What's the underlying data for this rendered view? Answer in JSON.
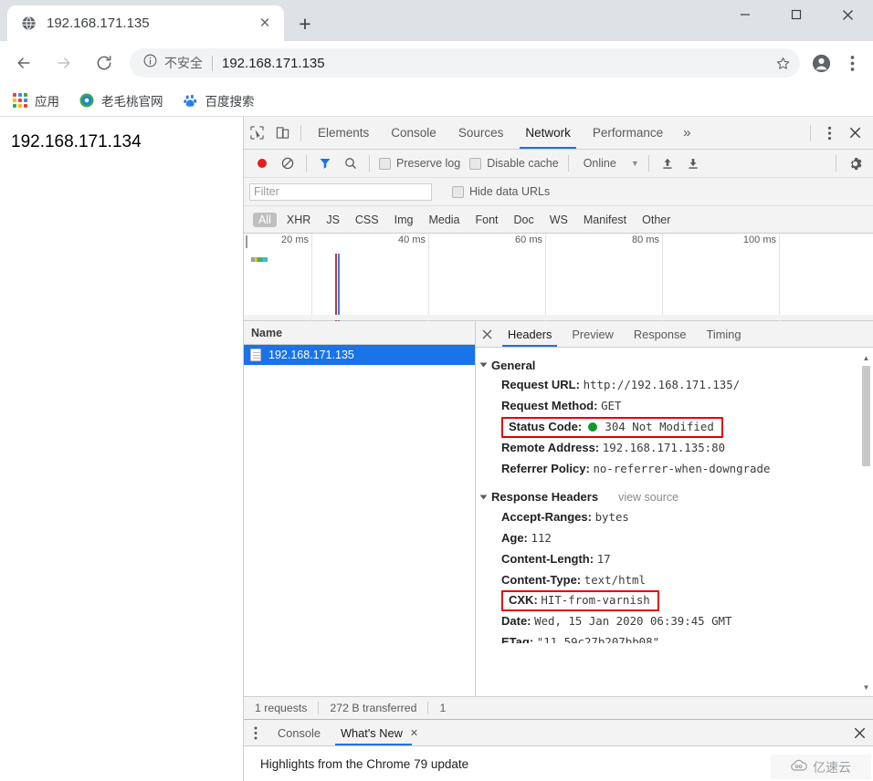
{
  "browser": {
    "tab": {
      "title": "192.168.171.135",
      "favicon": "globe-icon",
      "close": "×"
    },
    "newtab_label": "+",
    "window_controls": {
      "minimize": "—",
      "maximize": "□",
      "close": "✕"
    },
    "nav": {
      "back": "←",
      "forward": "→",
      "reload": "↻"
    },
    "omnibox": {
      "security_icon": "info-circle-icon",
      "security_text": "不安全",
      "url": "192.168.171.135",
      "star": "☆"
    },
    "profile_icon": "account-circle-icon",
    "menu_icon": "kebab-menu-icon",
    "bookmarks": [
      {
        "icon": "apps-grid-icon",
        "label": "应用"
      },
      {
        "icon": "laomaotao-icon",
        "label": "老毛桃官网"
      },
      {
        "icon": "baidu-paw-icon",
        "label": "百度搜索"
      }
    ]
  },
  "page": {
    "body_text": "192.168.171.134"
  },
  "devtools": {
    "inspect_icon": "inspect-element-icon",
    "device_icon": "device-toolbar-icon",
    "panels": [
      {
        "label": "Elements",
        "active": false
      },
      {
        "label": "Console",
        "active": false
      },
      {
        "label": "Sources",
        "active": false
      },
      {
        "label": "Network",
        "active": true
      },
      {
        "label": "Performance",
        "active": false
      }
    ],
    "more_panels": "»",
    "settings_kebab": "kebab-menu-icon",
    "close": "✕",
    "network_toolbar": {
      "record_icon": "record-button-icon",
      "clear_icon": "clear-icon",
      "filter_icon": "filter-funnel-icon",
      "search_icon": "search-icon",
      "preserve_log": "Preserve log",
      "disable_cache": "Disable cache",
      "throttling": "Online",
      "import_icon": "import-har-icon",
      "export_icon": "export-har-icon",
      "gear_icon": "gear-icon"
    },
    "filter": {
      "placeholder": "Filter",
      "value": "",
      "hide_data_urls": "Hide data URLs"
    },
    "resource_types": [
      "All",
      "XHR",
      "JS",
      "CSS",
      "Img",
      "Media",
      "Font",
      "Doc",
      "WS",
      "Manifest",
      "Other"
    ],
    "active_resource_type": "All",
    "overview": {
      "ticks": [
        "20 ms",
        "40 ms",
        "60 ms",
        "80 ms",
        "100 ms"
      ]
    },
    "request_list": {
      "column_header": "Name",
      "rows": [
        {
          "name": "192.168.171.135",
          "icon": "document-icon",
          "selected": true
        }
      ]
    },
    "detail_tabs": [
      {
        "label": "Headers",
        "active": true
      },
      {
        "label": "Preview",
        "active": false
      },
      {
        "label": "Response",
        "active": false
      },
      {
        "label": "Timing",
        "active": false
      }
    ],
    "sections": [
      {
        "title": "General",
        "view_source": "",
        "rows": [
          {
            "key": "Request URL:",
            "value": "http://192.168.171.135/",
            "highlight": false
          },
          {
            "key": "Request Method:",
            "value": "GET",
            "highlight": false
          },
          {
            "key": "Status Code:",
            "value": "304 Not Modified",
            "highlight": true,
            "status_dot": "#0c9b2a"
          },
          {
            "key": "Remote Address:",
            "value": "192.168.171.135:80",
            "highlight": false
          },
          {
            "key": "Referrer Policy:",
            "value": "no-referrer-when-downgrade",
            "highlight": false
          }
        ]
      },
      {
        "title": "Response Headers",
        "view_source": "view source",
        "rows": [
          {
            "key": "Accept-Ranges:",
            "value": "bytes",
            "highlight": false
          },
          {
            "key": "Age:",
            "value": "112",
            "highlight": false
          },
          {
            "key": "Content-Length:",
            "value": "17",
            "highlight": false
          },
          {
            "key": "Content-Type:",
            "value": "text/html",
            "highlight": false
          },
          {
            "key": "CXK:",
            "value": "HIT-from-varnish",
            "highlight": true
          },
          {
            "key": "Date:",
            "value": "Wed, 15 Jan 2020 06:39:45 GMT",
            "highlight": false
          },
          {
            "key": "ETag:",
            "value": "\"11_59c27b207bb08\"",
            "highlight": false,
            "clipped": true
          }
        ]
      }
    ],
    "status_bar": {
      "requests": "1 requests",
      "transferred": "272 B transferred",
      "resources": "1"
    },
    "drawer": {
      "kebab": "kebab-menu-icon",
      "tabs": [
        {
          "label": "Console",
          "active": false,
          "closable": false
        },
        {
          "label": "What's New",
          "active": true,
          "closable": true
        }
      ],
      "close": "✕",
      "content": "Highlights from the Chrome 79 update"
    }
  },
  "watermark": {
    "icon": "cloud-icon",
    "text": "亿速云"
  },
  "colors": {
    "accent_blue": "#1a73e8",
    "selection_blue": "#1a73e8",
    "highlight_red": "#e60000",
    "status_green": "#0c9b2a",
    "titlebar_bg": "#dee1e6",
    "devtools_bg": "#f3f3f3"
  }
}
